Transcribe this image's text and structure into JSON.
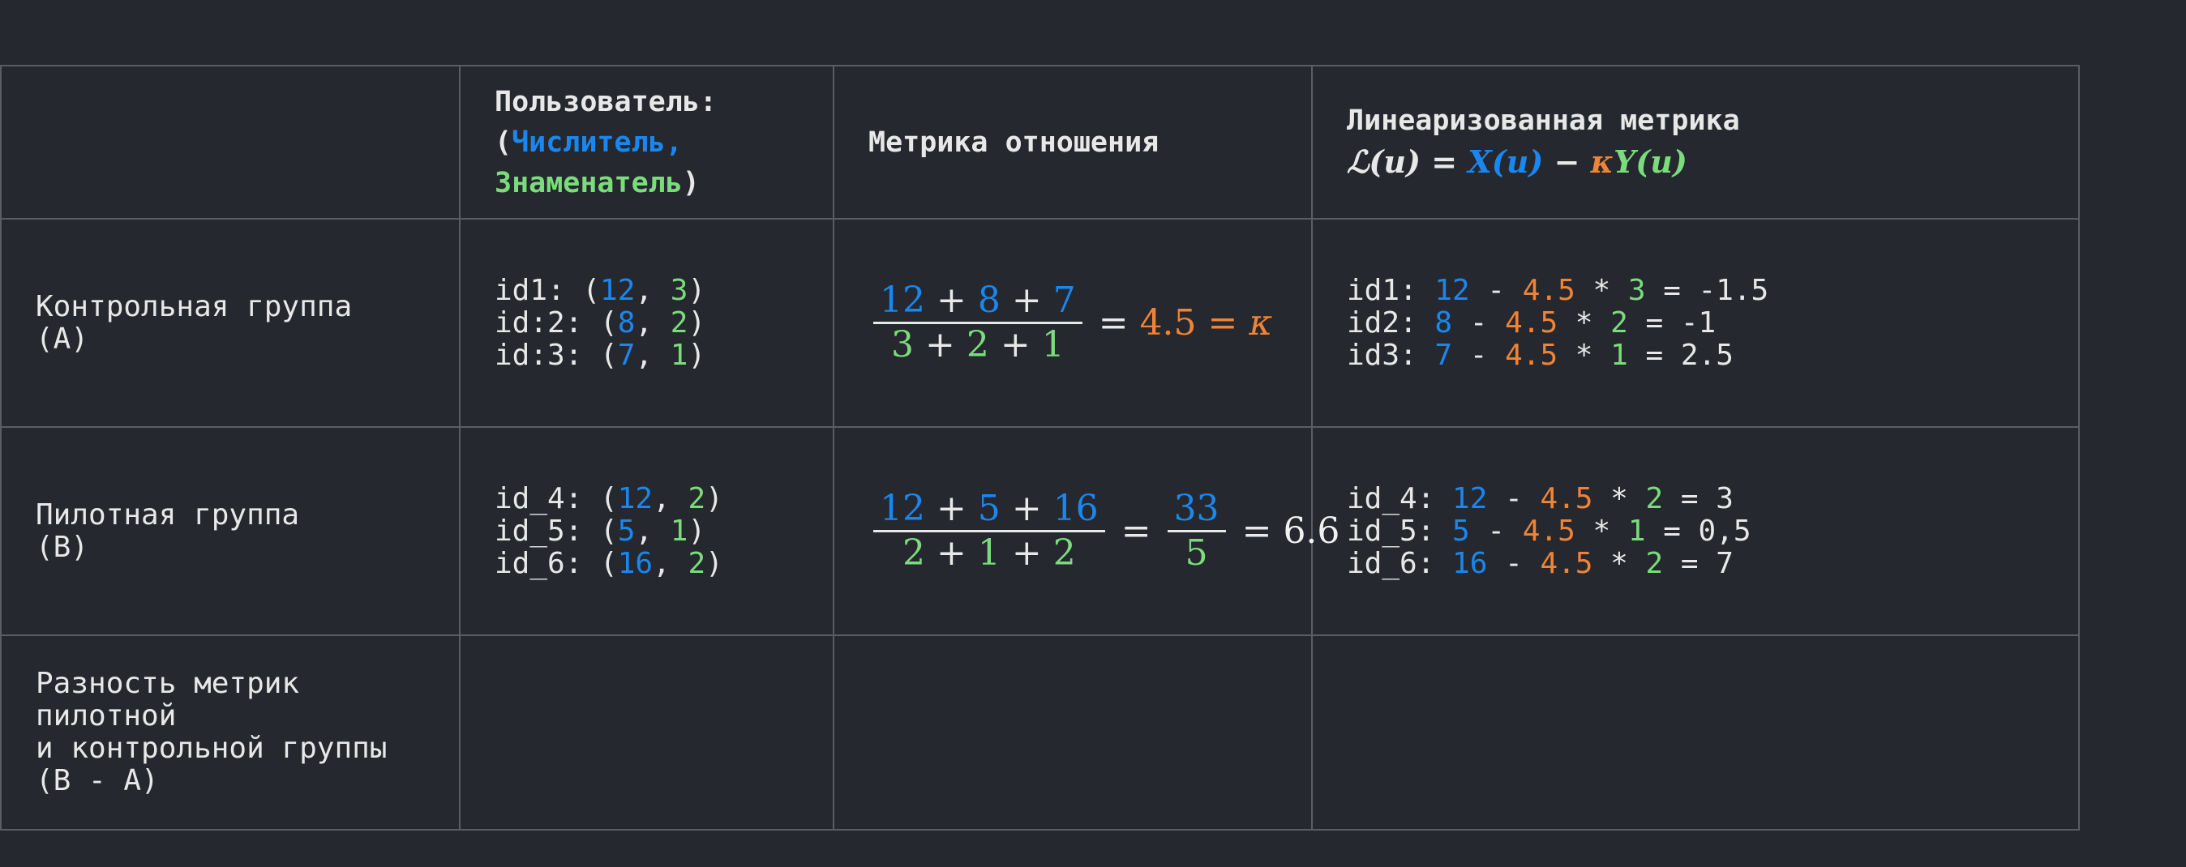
{
  "colors": {
    "numerator": "#1a87f0",
    "denominator": "#7bdc7b",
    "kappa": "#ef8436",
    "text": "#e8e8e8",
    "background": "#25282e",
    "border": "#5a5d63"
  },
  "header": {
    "col_user_title": "Пользователь:",
    "col_user_open": "(",
    "col_user_num": "Числитель,",
    "col_user_den": "Знаменатель",
    "col_user_close": ")",
    "col_ratio": "Метрика отношения",
    "col_linear": "Линеаризованная метрика",
    "formula": {
      "L": "ℒ",
      "u1": "(u) = ",
      "X": "X(u)",
      "minus": " − ",
      "kappa": "κ",
      "Y": "Y(u)"
    }
  },
  "rows": [
    {
      "label": "Контрольная группа\n(A)",
      "users": [
        {
          "id": "id1: (",
          "n": "12",
          "sep": ", ",
          "d": "3",
          "end": ")"
        },
        {
          "id": "id:2: (",
          "n": "8",
          "sep": ", ",
          "d": "2",
          "end": ")"
        },
        {
          "id": "id:3: (",
          "n": "7",
          "sep": ", ",
          "d": "1",
          "end": ")"
        }
      ],
      "ratio": {
        "numerator": [
          "12",
          "8",
          "7"
        ],
        "denominator": [
          "3",
          "2",
          "1"
        ],
        "result": "4.5",
        "kappa": "κ"
      },
      "linear": [
        {
          "id": "id1: ",
          "x": "12",
          "k": "4.5",
          "y": "3",
          "res": " = -1.5"
        },
        {
          "id": "id2: ",
          "x": "8",
          "k": "4.5",
          "y": "2",
          "res": " = -1"
        },
        {
          "id": "id3: ",
          "x": "7",
          "k": "4.5",
          "y": "1",
          "res": " = 2.5"
        }
      ]
    },
    {
      "label": "Пилотная группа\n(B)",
      "users": [
        {
          "id": "id_4: (",
          "n": "12",
          "sep": ", ",
          "d": "2",
          "end": ")"
        },
        {
          "id": "id_5: (",
          "n": "5",
          "sep": ", ",
          "d": "1",
          "end": ")"
        },
        {
          "id": "id_6: (",
          "n": "16",
          "sep": ", ",
          "d": "2",
          "end": ")"
        }
      ],
      "ratio": {
        "numerator": [
          "12",
          "5",
          "16"
        ],
        "denominator": [
          "2",
          "1",
          "2"
        ],
        "sum_num": "33",
        "sum_den": "5",
        "result": "6.6"
      },
      "linear": [
        {
          "id": "id_4: ",
          "x": "12",
          "k": "4.5",
          "y": "2",
          "res": " = 3"
        },
        {
          "id": "id_5: ",
          "x": "5",
          "k": "4.5",
          "y": "1",
          "res": " = 0,5"
        },
        {
          "id": "id_6: ",
          "x": "16",
          "k": "4.5",
          "y": "2",
          "res": " = 7"
        }
      ]
    },
    {
      "label": "Разность метрик\nпилотной\nи контрольной группы\n(B - A)"
    }
  ],
  "ops": {
    "plus": " + ",
    "minus": " - ",
    "times": " * ",
    "eq": "="
  }
}
